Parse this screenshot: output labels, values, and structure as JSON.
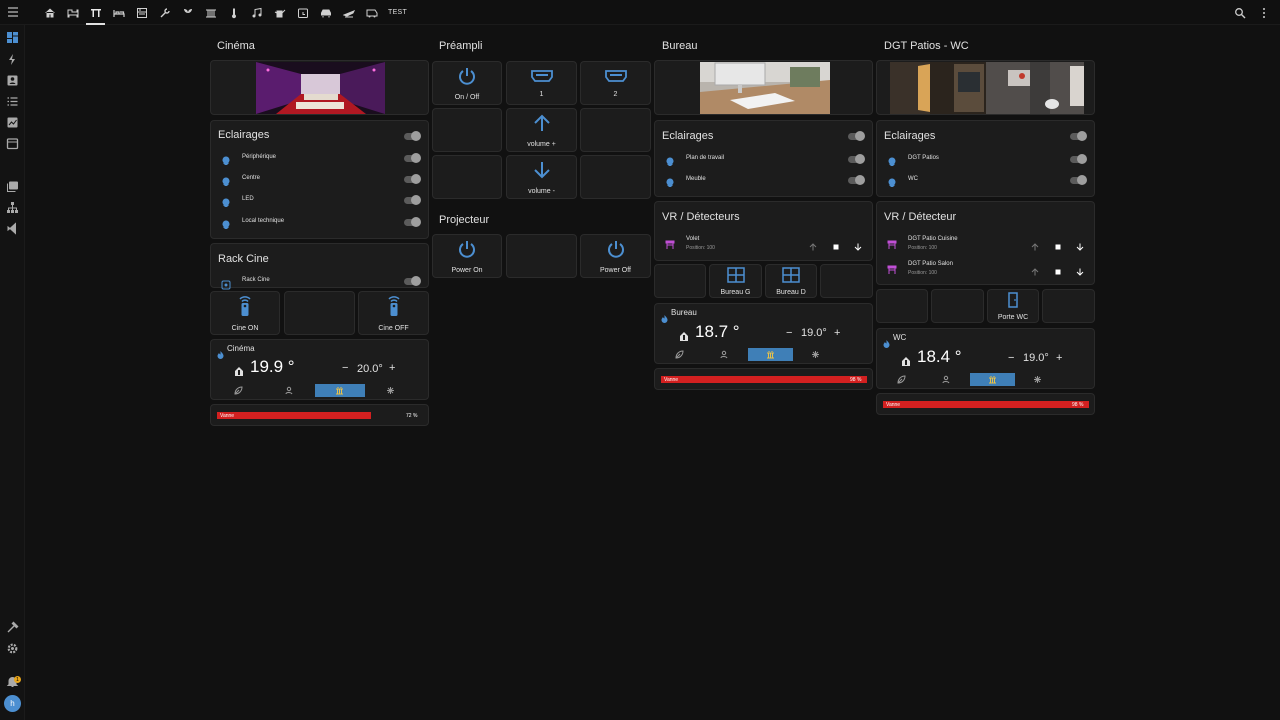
{
  "topbar": {
    "tabs": [
      "home-icon",
      "sofa-icon",
      "theater-icon",
      "bed-icon",
      "kitchen-icon",
      "tools-icon",
      "garden-icon",
      "radiator-icon",
      "thermometer-icon",
      "music-icon",
      "watering-can-icon",
      "calendar-clock-icon",
      "car-icon",
      "plane-icon",
      "camper-icon"
    ],
    "test_label": "TEST",
    "accent": "#e1e1e1"
  },
  "sidebar": {
    "items": [
      "dashboard-icon",
      "lightning-icon",
      "account-box-icon",
      "list-icon",
      "chart-icon",
      "calendar-icon",
      "media-icon",
      "sitemap-icon",
      "vscode-icon"
    ],
    "bottom": [
      "hammer-icon",
      "settings-icon",
      "bell-icon"
    ],
    "avatar": "h",
    "notifications": "1"
  },
  "cinema": {
    "title": "Cinéma",
    "lights": {
      "title": "Eclairages",
      "items": [
        {
          "label": "Périphérique"
        },
        {
          "label": "Centre"
        },
        {
          "label": "LED"
        },
        {
          "label": "Local technique"
        }
      ]
    },
    "rack": {
      "title": "Rack Cine",
      "item": "Rack Cine"
    },
    "buttons": [
      "Cine ON",
      "Cine OFF"
    ],
    "thermostat": {
      "name": "Cinéma",
      "current": "19.9 °",
      "target": "20.0°",
      "plus": "+",
      "minus": "−"
    },
    "vanne": {
      "label": "Vanne",
      "percent": "72 %",
      "value": 72
    }
  },
  "preampli": {
    "title": "Préampli",
    "buttons": [
      "On / Off",
      "1",
      "2",
      "volume +",
      "volume -"
    ]
  },
  "projecteur": {
    "title": "Projecteur",
    "buttons": [
      "Power On",
      "Power Off"
    ]
  },
  "bureau": {
    "title": "Bureau",
    "lights": {
      "title": "Eclairages",
      "items": [
        {
          "label": "Plan de travail"
        },
        {
          "label": "Meuble"
        }
      ]
    },
    "vr": {
      "title": "VR / Détecteurs",
      "items": [
        {
          "label": "Volet",
          "position": "Position: 100"
        }
      ]
    },
    "buttons": [
      "Bureau G",
      "Bureau D"
    ],
    "thermostat": {
      "name": "Bureau",
      "current": "18.7 °",
      "target": "19.0°",
      "plus": "+",
      "minus": "−"
    },
    "vanne": {
      "label": "Vanne",
      "percent": "98 %",
      "value": 98
    }
  },
  "dgt": {
    "title": "DGT Patios - WC",
    "lights": {
      "title": "Eclairages",
      "items": [
        {
          "label": "DGT Patios"
        },
        {
          "label": "WC"
        }
      ]
    },
    "vr": {
      "title": "VR / Détecteur",
      "items": [
        {
          "label": "DGT Patio Cuisine",
          "position": "Position: 100"
        },
        {
          "label": "DGT Patio Salon",
          "position": "Position: 100"
        }
      ]
    },
    "buttons": [
      "Porte WC"
    ],
    "thermostat": {
      "name": "WC",
      "current": "18.4 °",
      "target": "19.0°",
      "plus": "+",
      "minus": "−"
    },
    "vanne": {
      "label": "Vanne",
      "percent": "98 %",
      "value": 98
    }
  },
  "colors": {
    "accent_blue": "#4c8fd1",
    "shutter_purple": "#c14fd6",
    "vanne_red": "#d32020",
    "active_mode": "#3f7fb7",
    "heat_yellow": "#e8c24a"
  }
}
